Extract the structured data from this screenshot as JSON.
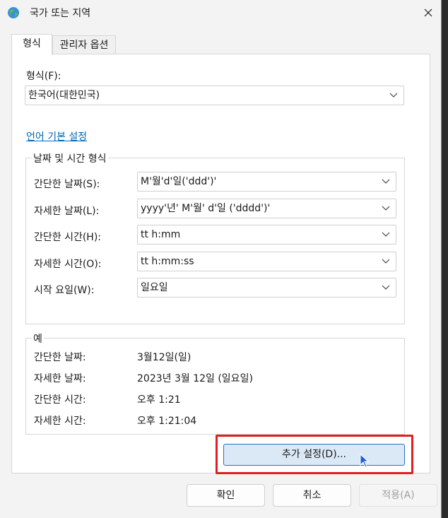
{
  "window": {
    "title": "국가 또는 지역"
  },
  "tabs": [
    {
      "label": "형식",
      "active": true
    },
    {
      "label": "관리자 옵션",
      "active": false
    }
  ],
  "format": {
    "label": "형식(F):",
    "value": "한국어(대한민국)"
  },
  "language_link": "언어 기본 설정",
  "datetime_group": {
    "title": "날짜 및 시간 형식",
    "rows": [
      {
        "label": "간단한 날짜(S):",
        "value": "M'월'd'일('ddd')'"
      },
      {
        "label": "자세한 날짜(L):",
        "value": "yyyy'년' M'월' d'일 ('dddd')'"
      },
      {
        "label": "간단한 시간(H):",
        "value": "tt h:mm"
      },
      {
        "label": "자세한 시간(O):",
        "value": "tt h:mm:ss"
      },
      {
        "label": "시작 요일(W):",
        "value": "일요일"
      }
    ]
  },
  "example_group": {
    "title": "예",
    "rows": [
      {
        "label": "간단한 날짜:",
        "value": "3월12일(일)"
      },
      {
        "label": "자세한 날짜:",
        "value": "2023년 3월 12일 (일요일)"
      },
      {
        "label": "간단한 시간:",
        "value": "오후 1:21"
      },
      {
        "label": "자세한 시간:",
        "value": "오후 1:21:04"
      }
    ]
  },
  "advanced_button": "추가 설정(D)...",
  "buttons": {
    "ok": "확인",
    "cancel": "취소",
    "apply": "적용(A)"
  },
  "colors": {
    "accent": "#0066b4",
    "highlight": "#e0201e",
    "button_focus": "#dbe9f7"
  }
}
